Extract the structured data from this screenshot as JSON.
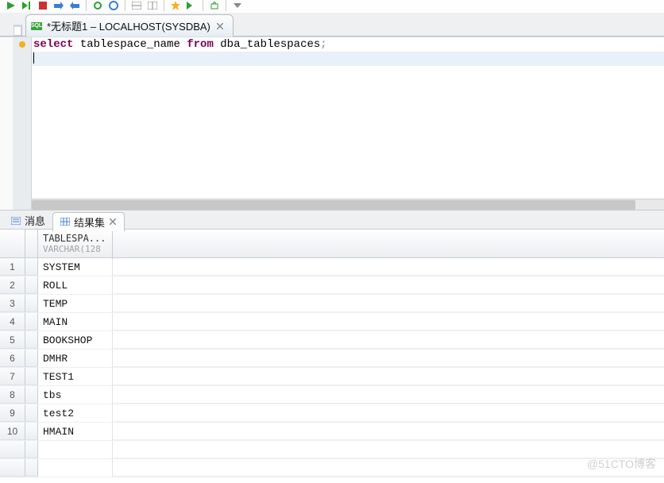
{
  "toolbar": {
    "icons": [
      "run-icon",
      "step-icon",
      "stop-icon",
      "commit-icon",
      "rollback-icon",
      "sep",
      "refresh-icon",
      "clear-icon",
      "sep",
      "explain-icon",
      "format-icon",
      "sep",
      "bookmark-icon",
      "next-icon",
      "sep",
      "export-icon",
      "sep",
      "more-icon"
    ]
  },
  "tab": {
    "icon_label": "SQL",
    "title": "*无标题1 – LOCALHOST(SYSDBA)"
  },
  "editor": {
    "line1": {
      "kw1": "select",
      "ident": " tablespace_name ",
      "kw2": "from",
      "rest": " dba_tablespaces",
      "end": ";"
    }
  },
  "result_tabs": {
    "messages": "消息",
    "results": "结果集"
  },
  "grid": {
    "column": {
      "name": "TABLESPA...",
      "type": "VARCHAR(128"
    },
    "rows": [
      {
        "n": "1",
        "v": "SYSTEM"
      },
      {
        "n": "2",
        "v": "ROLL"
      },
      {
        "n": "3",
        "v": "TEMP"
      },
      {
        "n": "4",
        "v": "MAIN"
      },
      {
        "n": "5",
        "v": "BOOKSHOP"
      },
      {
        "n": "6",
        "v": "DMHR"
      },
      {
        "n": "7",
        "v": "TEST1"
      },
      {
        "n": "8",
        "v": "tbs"
      },
      {
        "n": "9",
        "v": "test2"
      },
      {
        "n": "10",
        "v": "HMAIN"
      }
    ]
  },
  "watermark": "@51CTO博客",
  "colors": {
    "keyword": "#7b0052",
    "selection": "#e8f1f8"
  }
}
